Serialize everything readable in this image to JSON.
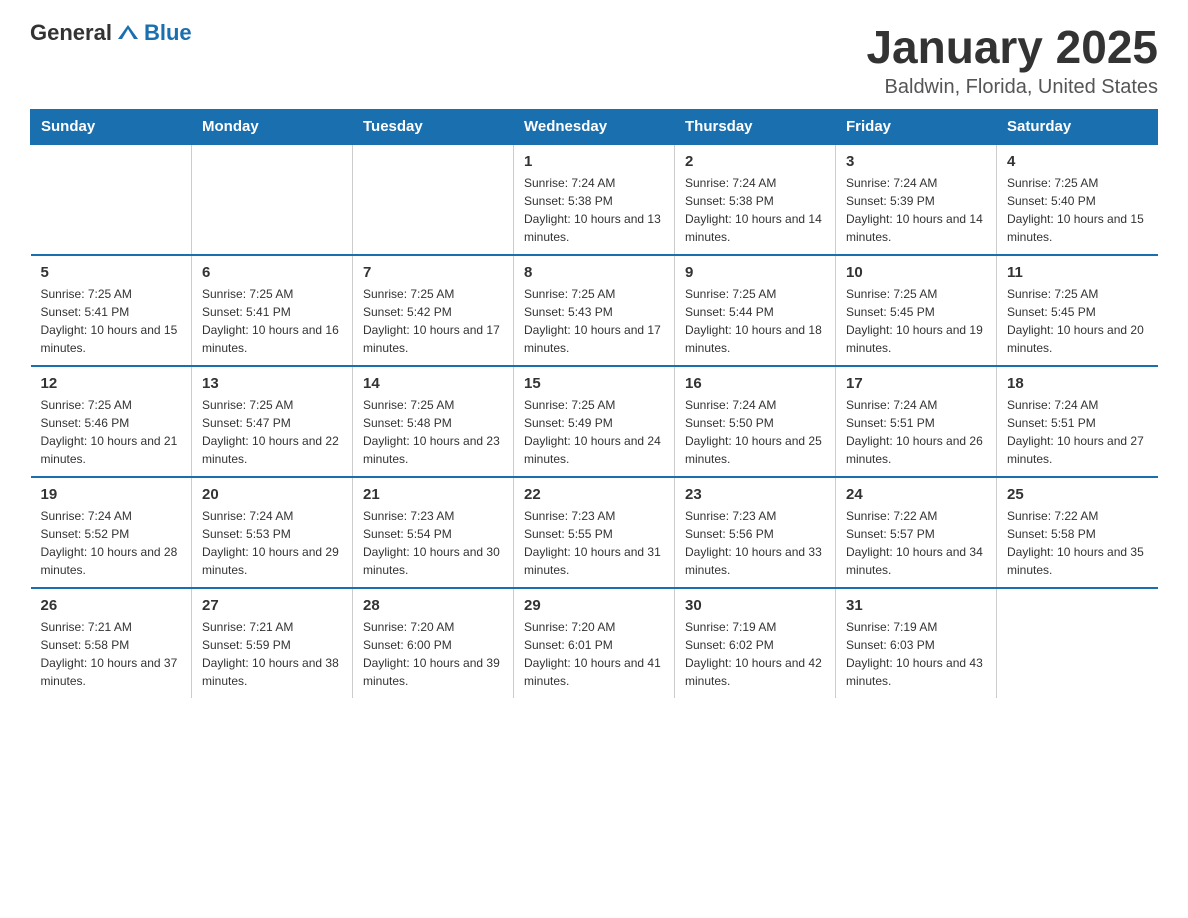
{
  "logo": {
    "general": "General",
    "blue": "Blue"
  },
  "title": "January 2025",
  "location": "Baldwin, Florida, United States",
  "headers": [
    "Sunday",
    "Monday",
    "Tuesday",
    "Wednesday",
    "Thursday",
    "Friday",
    "Saturday"
  ],
  "weeks": [
    [
      {
        "day": "",
        "sunrise": "",
        "sunset": "",
        "daylight": ""
      },
      {
        "day": "",
        "sunrise": "",
        "sunset": "",
        "daylight": ""
      },
      {
        "day": "",
        "sunrise": "",
        "sunset": "",
        "daylight": ""
      },
      {
        "day": "1",
        "sunrise": "Sunrise: 7:24 AM",
        "sunset": "Sunset: 5:38 PM",
        "daylight": "Daylight: 10 hours and 13 minutes."
      },
      {
        "day": "2",
        "sunrise": "Sunrise: 7:24 AM",
        "sunset": "Sunset: 5:38 PM",
        "daylight": "Daylight: 10 hours and 14 minutes."
      },
      {
        "day": "3",
        "sunrise": "Sunrise: 7:24 AM",
        "sunset": "Sunset: 5:39 PM",
        "daylight": "Daylight: 10 hours and 14 minutes."
      },
      {
        "day": "4",
        "sunrise": "Sunrise: 7:25 AM",
        "sunset": "Sunset: 5:40 PM",
        "daylight": "Daylight: 10 hours and 15 minutes."
      }
    ],
    [
      {
        "day": "5",
        "sunrise": "Sunrise: 7:25 AM",
        "sunset": "Sunset: 5:41 PM",
        "daylight": "Daylight: 10 hours and 15 minutes."
      },
      {
        "day": "6",
        "sunrise": "Sunrise: 7:25 AM",
        "sunset": "Sunset: 5:41 PM",
        "daylight": "Daylight: 10 hours and 16 minutes."
      },
      {
        "day": "7",
        "sunrise": "Sunrise: 7:25 AM",
        "sunset": "Sunset: 5:42 PM",
        "daylight": "Daylight: 10 hours and 17 minutes."
      },
      {
        "day": "8",
        "sunrise": "Sunrise: 7:25 AM",
        "sunset": "Sunset: 5:43 PM",
        "daylight": "Daylight: 10 hours and 17 minutes."
      },
      {
        "day": "9",
        "sunrise": "Sunrise: 7:25 AM",
        "sunset": "Sunset: 5:44 PM",
        "daylight": "Daylight: 10 hours and 18 minutes."
      },
      {
        "day": "10",
        "sunrise": "Sunrise: 7:25 AM",
        "sunset": "Sunset: 5:45 PM",
        "daylight": "Daylight: 10 hours and 19 minutes."
      },
      {
        "day": "11",
        "sunrise": "Sunrise: 7:25 AM",
        "sunset": "Sunset: 5:45 PM",
        "daylight": "Daylight: 10 hours and 20 minutes."
      }
    ],
    [
      {
        "day": "12",
        "sunrise": "Sunrise: 7:25 AM",
        "sunset": "Sunset: 5:46 PM",
        "daylight": "Daylight: 10 hours and 21 minutes."
      },
      {
        "day": "13",
        "sunrise": "Sunrise: 7:25 AM",
        "sunset": "Sunset: 5:47 PM",
        "daylight": "Daylight: 10 hours and 22 minutes."
      },
      {
        "day": "14",
        "sunrise": "Sunrise: 7:25 AM",
        "sunset": "Sunset: 5:48 PM",
        "daylight": "Daylight: 10 hours and 23 minutes."
      },
      {
        "day": "15",
        "sunrise": "Sunrise: 7:25 AM",
        "sunset": "Sunset: 5:49 PM",
        "daylight": "Daylight: 10 hours and 24 minutes."
      },
      {
        "day": "16",
        "sunrise": "Sunrise: 7:24 AM",
        "sunset": "Sunset: 5:50 PM",
        "daylight": "Daylight: 10 hours and 25 minutes."
      },
      {
        "day": "17",
        "sunrise": "Sunrise: 7:24 AM",
        "sunset": "Sunset: 5:51 PM",
        "daylight": "Daylight: 10 hours and 26 minutes."
      },
      {
        "day": "18",
        "sunrise": "Sunrise: 7:24 AM",
        "sunset": "Sunset: 5:51 PM",
        "daylight": "Daylight: 10 hours and 27 minutes."
      }
    ],
    [
      {
        "day": "19",
        "sunrise": "Sunrise: 7:24 AM",
        "sunset": "Sunset: 5:52 PM",
        "daylight": "Daylight: 10 hours and 28 minutes."
      },
      {
        "day": "20",
        "sunrise": "Sunrise: 7:24 AM",
        "sunset": "Sunset: 5:53 PM",
        "daylight": "Daylight: 10 hours and 29 minutes."
      },
      {
        "day": "21",
        "sunrise": "Sunrise: 7:23 AM",
        "sunset": "Sunset: 5:54 PM",
        "daylight": "Daylight: 10 hours and 30 minutes."
      },
      {
        "day": "22",
        "sunrise": "Sunrise: 7:23 AM",
        "sunset": "Sunset: 5:55 PM",
        "daylight": "Daylight: 10 hours and 31 minutes."
      },
      {
        "day": "23",
        "sunrise": "Sunrise: 7:23 AM",
        "sunset": "Sunset: 5:56 PM",
        "daylight": "Daylight: 10 hours and 33 minutes."
      },
      {
        "day": "24",
        "sunrise": "Sunrise: 7:22 AM",
        "sunset": "Sunset: 5:57 PM",
        "daylight": "Daylight: 10 hours and 34 minutes."
      },
      {
        "day": "25",
        "sunrise": "Sunrise: 7:22 AM",
        "sunset": "Sunset: 5:58 PM",
        "daylight": "Daylight: 10 hours and 35 minutes."
      }
    ],
    [
      {
        "day": "26",
        "sunrise": "Sunrise: 7:21 AM",
        "sunset": "Sunset: 5:58 PM",
        "daylight": "Daylight: 10 hours and 37 minutes."
      },
      {
        "day": "27",
        "sunrise": "Sunrise: 7:21 AM",
        "sunset": "Sunset: 5:59 PM",
        "daylight": "Daylight: 10 hours and 38 minutes."
      },
      {
        "day": "28",
        "sunrise": "Sunrise: 7:20 AM",
        "sunset": "Sunset: 6:00 PM",
        "daylight": "Daylight: 10 hours and 39 minutes."
      },
      {
        "day": "29",
        "sunrise": "Sunrise: 7:20 AM",
        "sunset": "Sunset: 6:01 PM",
        "daylight": "Daylight: 10 hours and 41 minutes."
      },
      {
        "day": "30",
        "sunrise": "Sunrise: 7:19 AM",
        "sunset": "Sunset: 6:02 PM",
        "daylight": "Daylight: 10 hours and 42 minutes."
      },
      {
        "day": "31",
        "sunrise": "Sunrise: 7:19 AM",
        "sunset": "Sunset: 6:03 PM",
        "daylight": "Daylight: 10 hours and 43 minutes."
      },
      {
        "day": "",
        "sunrise": "",
        "sunset": "",
        "daylight": ""
      }
    ]
  ]
}
